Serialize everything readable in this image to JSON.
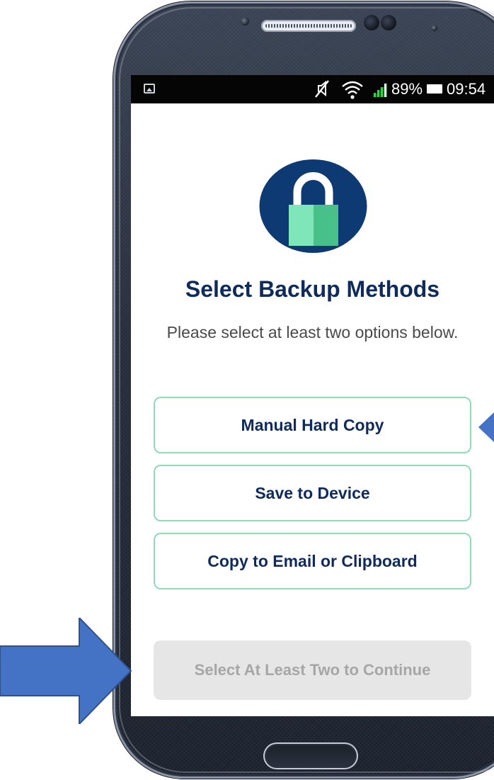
{
  "status_bar": {
    "battery_percent": "89%",
    "time": "09:54",
    "icons": [
      "gallery-icon",
      "mute-icon",
      "wifi-icon",
      "signal-icon",
      "battery-icon"
    ]
  },
  "header": {
    "icon": "lock-icon",
    "title": "Select Backup Methods",
    "subtitle": "Please select at least two options below."
  },
  "options": [
    {
      "label": "Manual Hard Copy"
    },
    {
      "label": "Save to Device"
    },
    {
      "label": "Copy to Email or Clipboard"
    }
  ],
  "continue_button": {
    "label": "Select At Least Two to Continue",
    "enabled": false
  },
  "colors": {
    "brand_navy": "#0f2b5b",
    "accent_green": "#8fdcb8",
    "lock_circle": "#0d3a73",
    "disabled_bg": "#e6e6e6",
    "annotation_arrow": "#4472c4"
  }
}
